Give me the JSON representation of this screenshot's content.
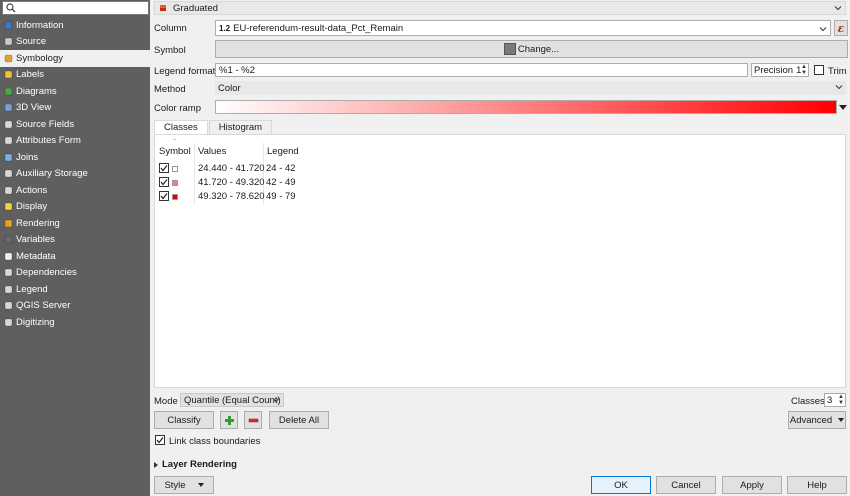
{
  "sidebar": {
    "search_placeholder": "",
    "items": [
      {
        "label": "Information",
        "icon": "info-icon",
        "color": "#3a78c8"
      },
      {
        "label": "Source",
        "icon": "wrench-icon",
        "color": "#c9c9c9"
      },
      {
        "label": "Symbology",
        "icon": "paintbrush-icon",
        "color": "#e5a025",
        "active": true
      },
      {
        "label": "Labels",
        "icon": "labels-icon",
        "color": "#f0c030"
      },
      {
        "label": "Diagrams",
        "icon": "diagram-icon",
        "color": "#49a548"
      },
      {
        "label": "3D View",
        "icon": "cube-icon",
        "color": "#7a9fd0"
      },
      {
        "label": "Source Fields",
        "icon": "fields-icon",
        "color": "#d8d8d8"
      },
      {
        "label": "Attributes Form",
        "icon": "form-icon",
        "color": "#d8d8d8"
      },
      {
        "label": "Joins",
        "icon": "join-icon",
        "color": "#7ab0e0"
      },
      {
        "label": "Auxiliary Storage",
        "icon": "storage-icon",
        "color": "#d8d8d8"
      },
      {
        "label": "Actions",
        "icon": "actions-icon",
        "color": "#d8d8d8"
      },
      {
        "label": "Display",
        "icon": "speech-bubble-icon",
        "color": "#f2d23a"
      },
      {
        "label": "Rendering",
        "icon": "rendering-brush-icon",
        "color": "#e5a025"
      },
      {
        "label": "Variables",
        "icon": "variables-icon",
        "color": "#6a6a6a"
      },
      {
        "label": "Metadata",
        "icon": "metadata-icon",
        "color": "#f0f0f0"
      },
      {
        "label": "Dependencies",
        "icon": "dependencies-icon",
        "color": "#d8d8d8"
      },
      {
        "label": "Legend",
        "icon": "legend-icon",
        "color": "#d8d8d8"
      },
      {
        "label": "QGIS Server",
        "icon": "server-icon",
        "color": "#d8d8d8"
      },
      {
        "label": "Digitizing",
        "icon": "digitizing-icon",
        "color": "#d8d8d8"
      }
    ]
  },
  "renderer": {
    "label": "Graduated",
    "icon": "graduated-icon"
  },
  "column": {
    "label": "Column",
    "value": "EU-referendum-result-data_Pct_Remain",
    "type_badge": "1.2",
    "expr_icon": "expression-icon"
  },
  "symbol": {
    "label": "Symbol",
    "button_label": "Change..."
  },
  "legend_format": {
    "label": "Legend format",
    "value": "%1 - %2",
    "precision_label": "Precision",
    "precision_value": "1",
    "trim_label": "Trim"
  },
  "method": {
    "label": "Method",
    "value": "Color"
  },
  "color_ramp": {
    "label": "Color ramp",
    "start": "#ffffff",
    "end": "#ff0000"
  },
  "tabs": [
    {
      "label": "Classes",
      "active": true
    },
    {
      "label": "Histogram",
      "active": false
    }
  ],
  "classes": {
    "headers": {
      "symbol": "Symbol",
      "values": "Values",
      "legend": "Legend"
    },
    "rows": [
      {
        "values": "24.440 - 41.720",
        "legend": "24 - 42",
        "color": "#fdfdfd",
        "checked": true
      },
      {
        "values": "41.720 - 49.320",
        "legend": "42 - 49",
        "color": "#f08080",
        "checked": true
      },
      {
        "values": "49.320 - 78.620",
        "legend": "49 - 79",
        "color": "#e00000",
        "checked": true
      }
    ]
  },
  "mode": {
    "label": "Mode",
    "value": "Quantile (Equal Count)"
  },
  "classes_count": {
    "label": "Classes",
    "value": "3"
  },
  "actions": {
    "classify": "Classify",
    "delete_all": "Delete All",
    "advanced": "Advanced"
  },
  "link_boundaries": {
    "label": "Link class boundaries",
    "checked": true
  },
  "layer_rendering": {
    "label": "Layer Rendering"
  },
  "footer": {
    "style": "Style",
    "ok": "OK",
    "cancel": "Cancel",
    "apply": "Apply",
    "help": "Help"
  }
}
